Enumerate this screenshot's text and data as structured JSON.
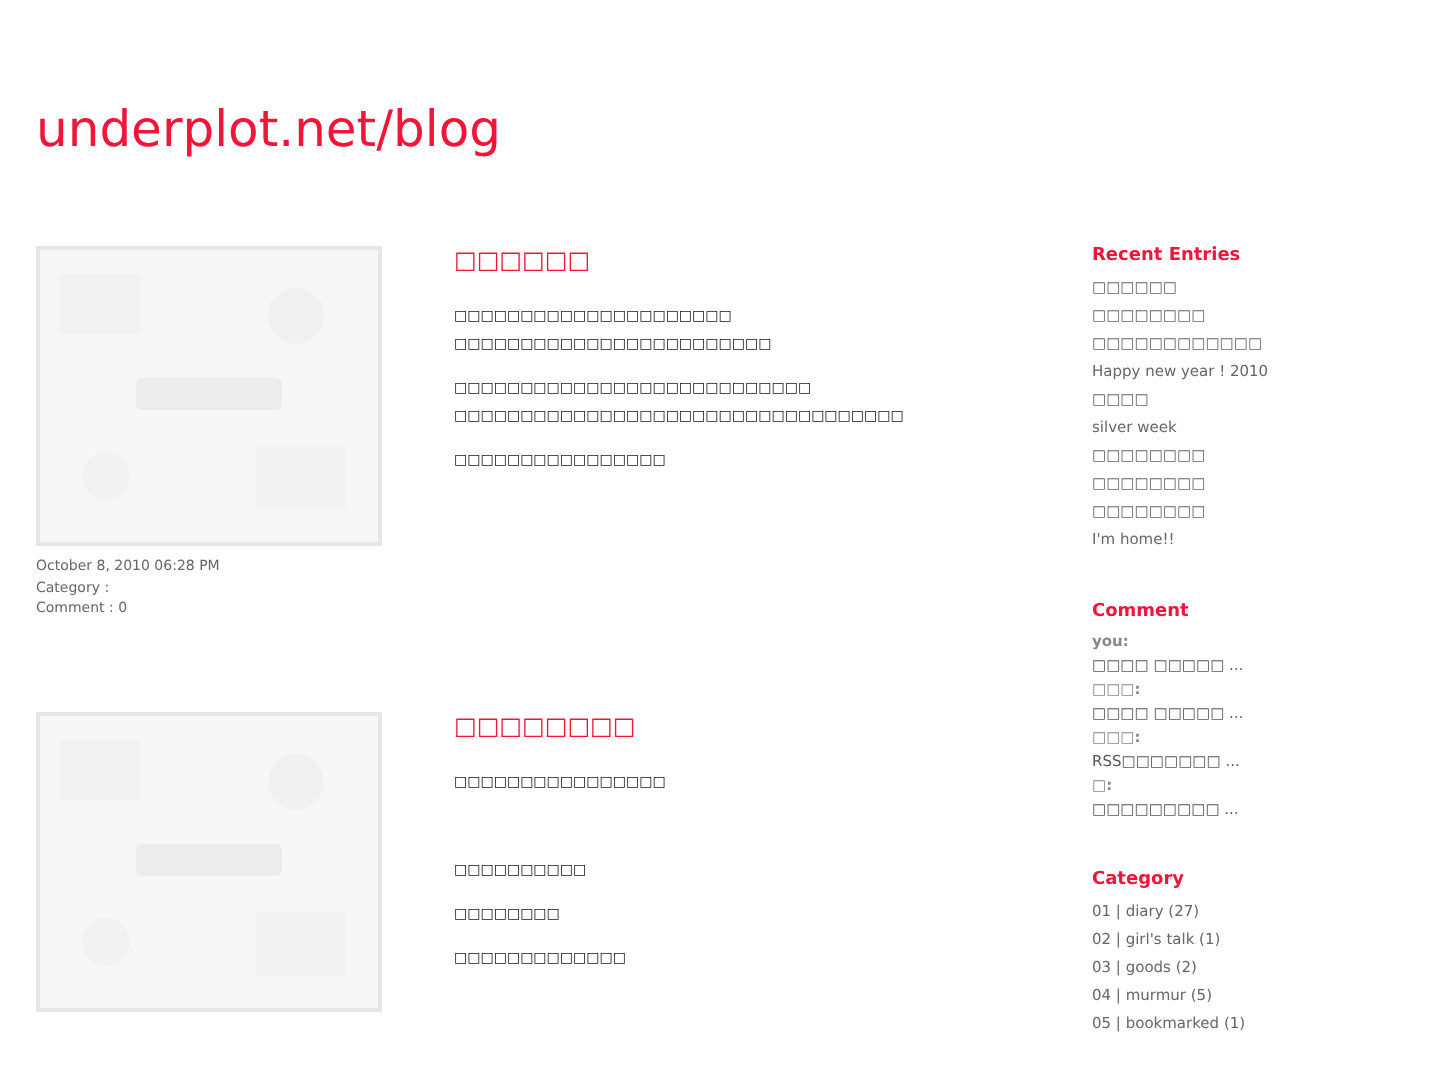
{
  "site_title": "underplot.net/blog",
  "posts": [
    {
      "image": {
        "kind": "picture"
      },
      "title": "□□□□□□",
      "meta": [
        "October 8, 2010 06:28 PM",
        "Category :",
        "Comment : 0"
      ],
      "paragraphs": [
        {
          "lines": [
            "□□□□□□□□□□□□□□□□□□□□□",
            "□□□□□□□□□□□□□□□□□□□□□□□□"
          ]
        },
        {
          "lines": [
            "□□□□□□□□□□□□□□□□□□□□□□□□□□□",
            "□□□□□□□□□□□□□□□□□□□□□□□□□□□□□□□□□□"
          ]
        },
        {
          "lines": [
            "□□□□□□□□□□□□□□□□"
          ]
        }
      ]
    },
    {
      "image": {
        "kind": "picture"
      },
      "title": "□□□□□□□□",
      "paragraphs": [
        {
          "lines": [
            "□□□□□□□□□□□□□□□□"
          ]
        },
        {
          "lines": [
            "□□□□□□□□□□"
          ],
          "space_before": true
        },
        {
          "lines": [
            "□□□□□□□□"
          ]
        },
        {
          "lines": [
            "□□□□□□□□□□□□□"
          ]
        }
      ]
    }
  ],
  "sidebar": {
    "recent_entries": {
      "heading": "Recent Entries",
      "items": [
        "□□□□□□",
        "□□□□□□□□",
        "□□□□□□□□□□□□",
        "Happy new year ! 2010",
        "□□□□",
        "silver week",
        "□□□□□□□□",
        "□□□□□□□□",
        "□□□□□□□□",
        "I'm home!!"
      ]
    },
    "comment": {
      "heading": "Comment",
      "items": [
        {
          "author": "you:",
          "excerpt": "□□□□ □□□□□ ..."
        },
        {
          "author": "□□□:",
          "excerpt": "□□□□ □□□□□ ..."
        },
        {
          "author": "□□□:",
          "excerpt": "RSS□□□□□□□ ..."
        },
        {
          "author": "□:",
          "excerpt": "□□□□□□□□□ ..."
        }
      ]
    },
    "category": {
      "heading": "Category",
      "items": [
        "01 | diary (27)",
        "02 | girl's talk (1)",
        "03 | goods (2)",
        "04 | murmur (5)",
        "05 | bookmarked (1)"
      ]
    }
  }
}
